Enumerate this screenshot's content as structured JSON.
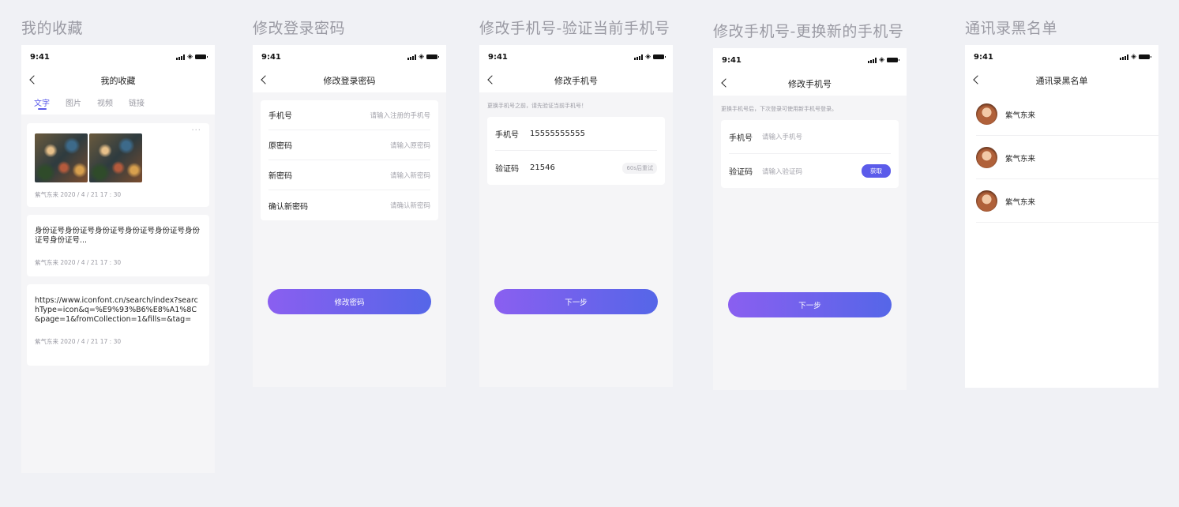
{
  "status": {
    "time": "9:41"
  },
  "screens": {
    "favorites": {
      "board_title": "我的收藏",
      "nav_title": "我的收藏",
      "tabs": [
        "文字",
        "图片",
        "视频",
        "链接"
      ],
      "more": "···",
      "cards": [
        {
          "meta": "紫气东来   2020 / 4 / 21  17 : 30"
        },
        {
          "text": "身份证号身份证号身份证号身份证号身份证号身份证号身份证号...",
          "meta": "紫气东来   2020 / 4 / 21  17 : 30"
        },
        {
          "text": "https://www.iconfont.cn/search/index?searchType=icon&q=%E9%93%B6%E8%A1%8C&page=1&fromCollection=1&fills=&tag=",
          "meta": "紫气东来   2020 / 4 / 21  17 : 30"
        }
      ]
    },
    "change_password": {
      "board_title": "修改登录密码",
      "nav_title": "修改登录密码",
      "fields": [
        {
          "label": "手机号",
          "placeholder": "请输入注册的手机号"
        },
        {
          "label": "原密码",
          "placeholder": "请输入原密码"
        },
        {
          "label": "新密码",
          "placeholder": "请输入新密码"
        },
        {
          "label": "确认新密码",
          "placeholder": "请确认新密码"
        }
      ],
      "button": "修改密码"
    },
    "verify_phone": {
      "board_title": "修改手机号-验证当前手机号",
      "nav_title": "修改手机号",
      "hint": "更换手机号之前，请先验证当前手机号！",
      "phone_label": "手机号",
      "phone_value": "15555555555",
      "code_label": "验证码",
      "code_value": "21546",
      "countdown": "60s后重试",
      "button": "下一步"
    },
    "new_phone": {
      "board_title": "修改手机号-更换新的手机号",
      "nav_title": "修改手机号",
      "hint": "更换手机号后，下次登录可使用新手机号登录。",
      "phone_label": "手机号",
      "phone_placeholder": "请输入手机号",
      "code_label": "验证码",
      "code_placeholder": "请输入验证码",
      "get_code": "获取",
      "button": "下一步"
    },
    "blacklist": {
      "board_title": "通讯录黑名单",
      "nav_title": "通讯录黑名单",
      "contacts": [
        "紫气东来",
        "紫气东来",
        "紫气东来"
      ]
    }
  },
  "colors": {
    "accent": "#5b5bea",
    "gradient_start": "#8a5ff0",
    "gradient_end": "#5566e8",
    "background": "#f0f1f5"
  }
}
